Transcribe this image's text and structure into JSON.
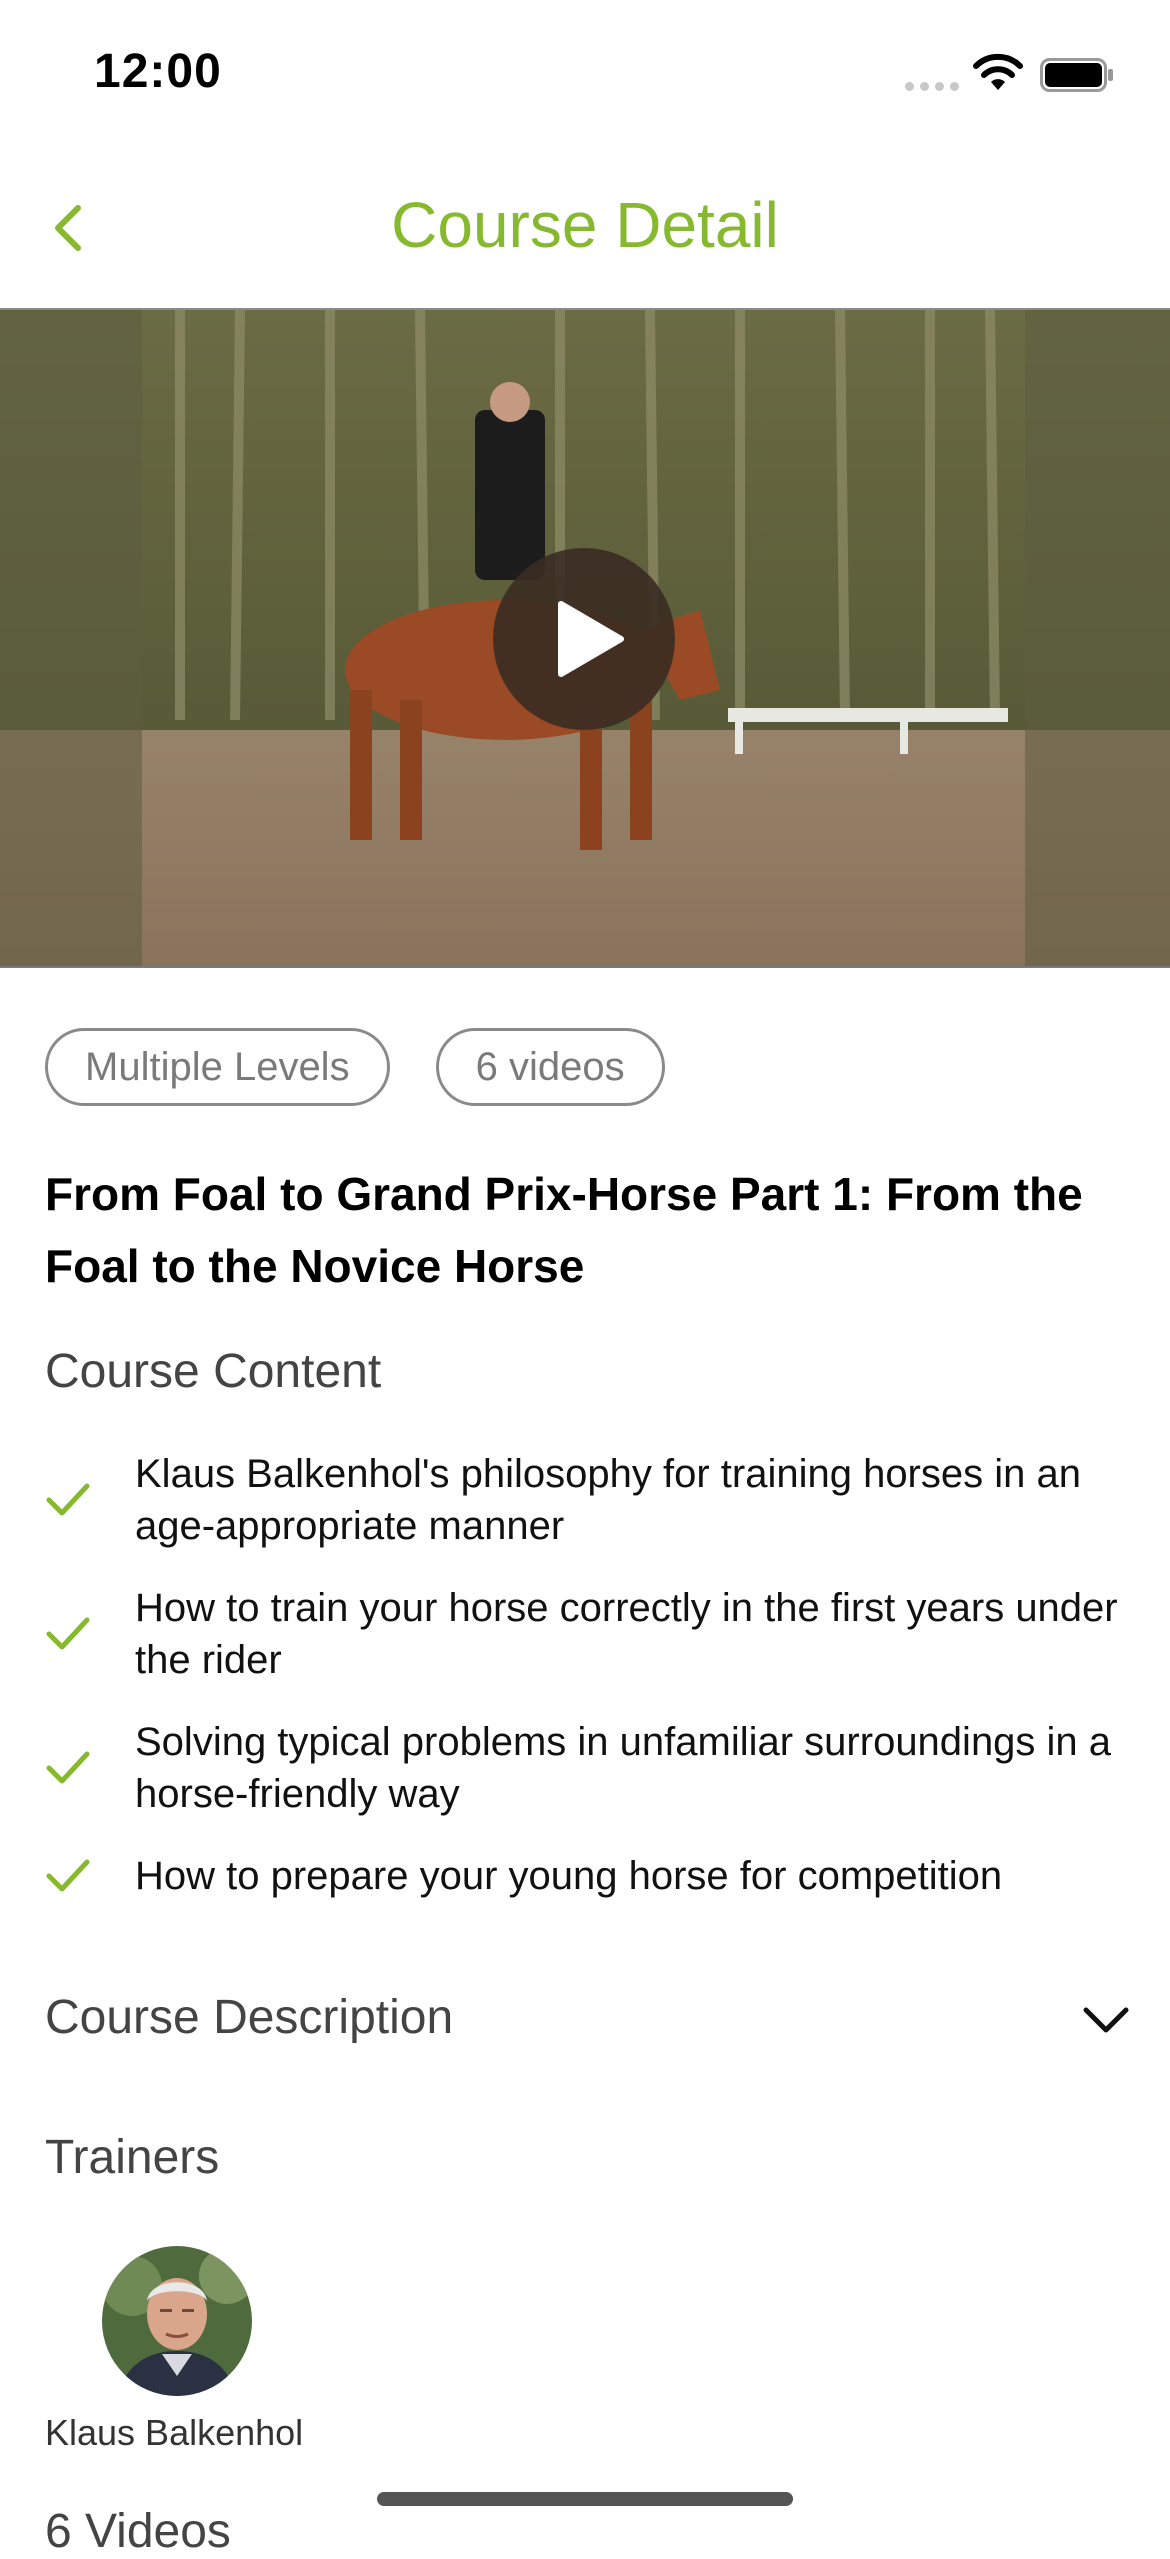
{
  "status_bar": {
    "time": "12:00"
  },
  "nav": {
    "title": "Course Detail",
    "back_icon": "chevron-left-icon"
  },
  "video": {
    "play_icon": "play-icon"
  },
  "tags": {
    "level": "Multiple Levels",
    "videos": "6 videos"
  },
  "course": {
    "title": "From Foal to Grand Prix-Horse Part 1: From the Foal to the Novice Horse"
  },
  "content": {
    "heading": "Course Content",
    "items": [
      "Klaus Balkenhol's philosophy for training horses in an age-appropriate manner",
      "How to train your horse correctly in the first years under the rider",
      "Solving typical problems in unfamiliar surroundings in a horse-friendly way",
      "How to prepare your young horse for competition"
    ]
  },
  "description": {
    "heading": "Course Description"
  },
  "trainers": {
    "heading": "Trainers",
    "list": [
      {
        "name": "Klaus Balkenhol"
      }
    ]
  },
  "next_section": {
    "partial_label": "6 Videos"
  },
  "colors": {
    "accent": "#86b92e",
    "chip_border": "#8a8a8a"
  }
}
